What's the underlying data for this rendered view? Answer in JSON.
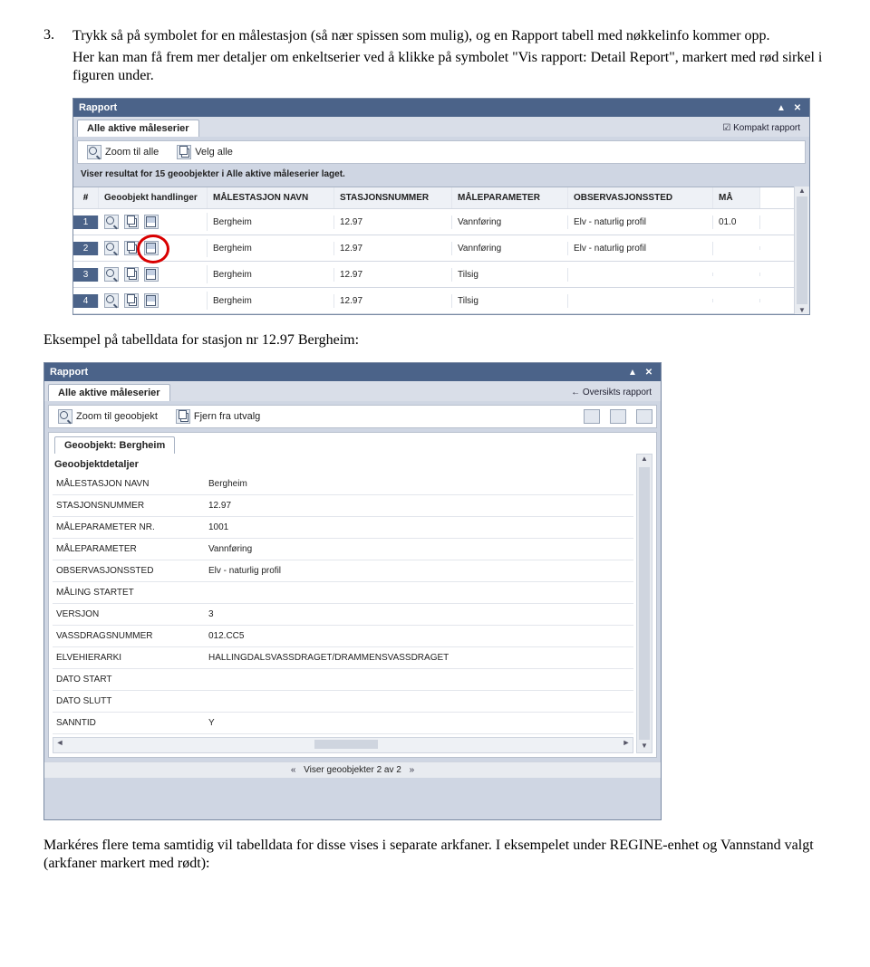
{
  "doc": {
    "list_num": "3.",
    "step3": "Trykk så på symbolet for en målestasjon (så nær spissen som mulig), og en Rapport tabell med nøkkelinfo kommer opp.",
    "step3b": "Her kan man få frem mer detaljer om enkeltserier ved å klikke på symbolet \"Vis rapport: Detail Report\", markert med rød sirkel i figuren under.",
    "mid": "Eksempel på tabelldata for stasjon nr 12.97 Bergheim:",
    "end": "Markéres flere tema samtidig vil tabelldata for disse vises i separate arkfaner. I eksempelet under REGINE-enhet og Vannstand valgt (arkfaner markert med rødt):"
  },
  "panel1": {
    "title": "Rapport",
    "tab": "Alle aktive måleserier",
    "kompakt": "Kompakt rapport",
    "zoom_all": "Zoom til alle",
    "velg_alle": "Velg alle",
    "status_a": "Viser resultat for ",
    "status_b": "15 geoobjekter",
    "status_c": " i ",
    "status_d": "Alle aktive måleserier",
    "status_e": " laget.",
    "cols": {
      "idx": "#",
      "act": "Geoobjekt handlinger",
      "name": "MÅLESTASJON NAVN",
      "num": "STASJONSNUMMER",
      "param": "MÅLEPARAMETER",
      "obs": "OBSERVASJONSSTED",
      "last": "MÅ"
    },
    "rows": [
      {
        "idx": "1",
        "name": "Bergheim",
        "num": "12.97",
        "param": "Vannføring",
        "obs": "Elv - naturlig profil",
        "last": "01.0"
      },
      {
        "idx": "2",
        "name": "Bergheim",
        "num": "12.97",
        "param": "Vannføring",
        "obs": "Elv - naturlig profil",
        "last": ""
      },
      {
        "idx": "3",
        "name": "Bergheim",
        "num": "12.97",
        "param": "Tilsig",
        "obs": "",
        "last": ""
      },
      {
        "idx": "4",
        "name": "Bergheim",
        "num": "12.97",
        "param": "Tilsig",
        "obs": "",
        "last": ""
      }
    ]
  },
  "panel2": {
    "title": "Rapport",
    "tab": "Alle aktive måleserier",
    "oversikt": "Oversikts rapport",
    "zoom_geo": "Zoom til geoobjekt",
    "fjern": "Fjern fra utvalg",
    "inner_tab": "Geoobjekt: Bergheim",
    "section": "Geoobjektdetaljer",
    "kv": [
      {
        "k": "MÅLESTASJON NAVN",
        "v": "Bergheim"
      },
      {
        "k": "STASJONSNUMMER",
        "v": "12.97"
      },
      {
        "k": "MÅLEPARAMETER NR.",
        "v": "1001"
      },
      {
        "k": "MÅLEPARAMETER",
        "v": "Vannføring"
      },
      {
        "k": "OBSERVASJONSSTED",
        "v": "Elv - naturlig profil"
      },
      {
        "k": "MÅLING STARTET",
        "v": ""
      },
      {
        "k": "VERSJON",
        "v": "3"
      },
      {
        "k": "VASSDRAGSNUMMER",
        "v": "012.CC5"
      },
      {
        "k": "ELVEHIERARKI",
        "v": "HALLINGDALSVASSDRAGET/DRAMMENSVASSDRAGET"
      },
      {
        "k": "DATO START",
        "v": ""
      },
      {
        "k": "DATO SLUTT",
        "v": ""
      },
      {
        "k": "SANNTID",
        "v": "Y"
      }
    ],
    "footer": "Viser geoobjekter 2 av 2",
    "nav_prev": "«",
    "nav_next": "»"
  }
}
